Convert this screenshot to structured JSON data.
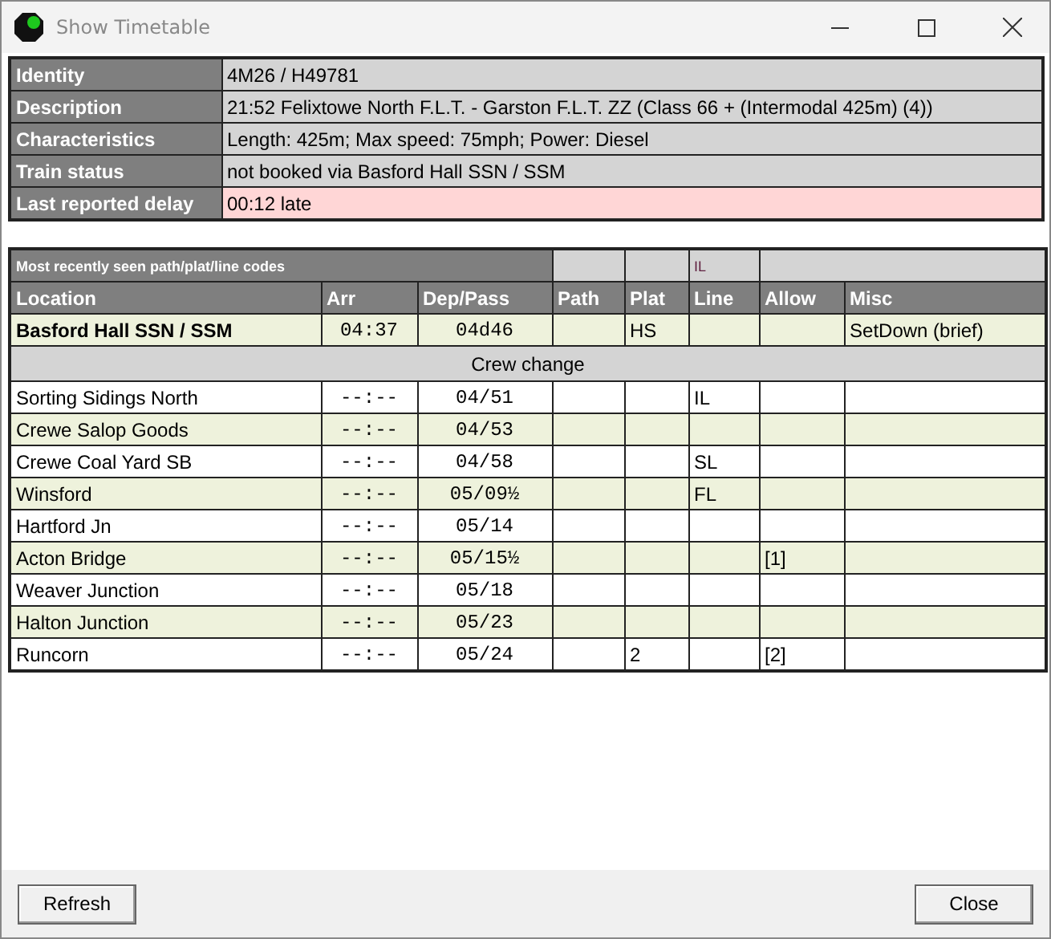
{
  "window": {
    "title": "Show Timetable"
  },
  "details": [
    {
      "label": "Identity",
      "value": "4M26 / H49781",
      "highlight": false
    },
    {
      "label": "Description",
      "value": "21:52 Felixtowe North F.L.T. - Garston F.L.T. ZZ (Class 66 + (Intermodal 425m) (4))",
      "highlight": false
    },
    {
      "label": "Characteristics",
      "value": "Length: 425m; Max speed: 75mph; Power: Diesel",
      "highlight": false
    },
    {
      "label": "Train status",
      "value": "not booked via Basford Hall SSN / SSM",
      "highlight": false
    },
    {
      "label": "Last reported delay",
      "value": "00:12 late",
      "highlight": true
    }
  ],
  "codes": {
    "title": "Most recently seen path/plat/line codes",
    "line": "IL"
  },
  "columns": [
    "Location",
    "Arr",
    "Dep/Pass",
    "Path",
    "Plat",
    "Line",
    "Allow",
    "Misc"
  ],
  "rows": [
    {
      "kind": "stop",
      "current": true,
      "cells": [
        "Basford Hall SSN / SSM",
        "04:37",
        "04d46",
        "",
        "HS",
        "",
        "",
        "SetDown (brief)"
      ]
    },
    {
      "kind": "note",
      "text": "Crew change"
    },
    {
      "kind": "stop",
      "current": false,
      "cells": [
        "Sorting Sidings North",
        "--:--",
        "04/51",
        "",
        "",
        "IL",
        "",
        ""
      ]
    },
    {
      "kind": "stop",
      "current": false,
      "cells": [
        "Crewe Salop Goods",
        "--:--",
        "04/53",
        "",
        "",
        "",
        "",
        ""
      ]
    },
    {
      "kind": "stop",
      "current": false,
      "cells": [
        "Crewe Coal Yard SB",
        "--:--",
        "04/58",
        "",
        "",
        "SL",
        "",
        ""
      ]
    },
    {
      "kind": "stop",
      "current": false,
      "cells": [
        "Winsford",
        "--:--",
        "05/09½",
        "",
        "",
        "FL",
        "",
        ""
      ]
    },
    {
      "kind": "stop",
      "current": false,
      "cells": [
        "Hartford Jn",
        "--:--",
        "05/14",
        "",
        "",
        "",
        "",
        ""
      ]
    },
    {
      "kind": "stop",
      "current": false,
      "cells": [
        "Acton Bridge",
        "--:--",
        "05/15½",
        "",
        "",
        "",
        "[1]",
        ""
      ]
    },
    {
      "kind": "stop",
      "current": false,
      "cells": [
        "Weaver Junction",
        "--:--",
        "05/18",
        "",
        "",
        "",
        "",
        ""
      ]
    },
    {
      "kind": "stop",
      "current": false,
      "cells": [
        "Halton Junction",
        "--:--",
        "05/23",
        "",
        "",
        "",
        "",
        ""
      ]
    },
    {
      "kind": "stop",
      "current": false,
      "cells": [
        "Runcorn",
        "--:--",
        "05/24",
        "",
        "2",
        "",
        "[2]",
        ""
      ]
    }
  ],
  "buttons": [
    {
      "label": "Refresh"
    },
    {
      "label": "Close"
    }
  ]
}
